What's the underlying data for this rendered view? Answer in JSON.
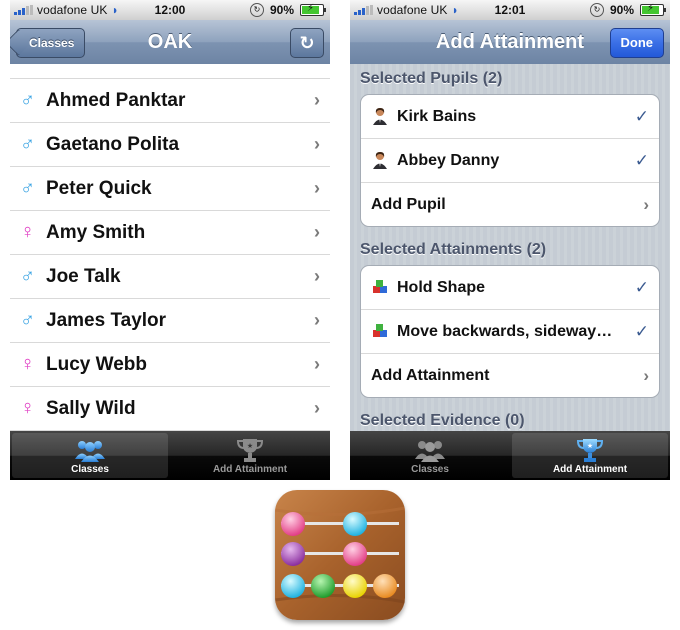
{
  "left": {
    "status": {
      "carrier": "vodafone UK",
      "time": "12:00",
      "battery": "90%"
    },
    "nav": {
      "back": "Classes",
      "title": "OAK",
      "refresh_icon": "refresh-icon"
    },
    "pupils": [
      {
        "name": "Ahmed Panktar",
        "gender": "male"
      },
      {
        "name": "Gaetano Polita",
        "gender": "male"
      },
      {
        "name": "Peter Quick",
        "gender": "male"
      },
      {
        "name": "Amy Smith",
        "gender": "female"
      },
      {
        "name": "Joe Talk",
        "gender": "male"
      },
      {
        "name": "James Taylor",
        "gender": "male"
      },
      {
        "name": "Lucy Webb",
        "gender": "female"
      },
      {
        "name": "Sally Wild",
        "gender": "female"
      }
    ],
    "tabs": [
      {
        "label": "Classes",
        "active": true
      },
      {
        "label": "Add Attainment",
        "active": false
      }
    ]
  },
  "right": {
    "status": {
      "carrier": "vodafone UK",
      "time": "12:01",
      "battery": "90%"
    },
    "nav": {
      "title": "Add Attainment",
      "done": "Done"
    },
    "sections": {
      "pupils_header": "Selected Pupils (2)",
      "pupils": [
        {
          "label": "Kirk Bains"
        },
        {
          "label": "Abbey Danny"
        }
      ],
      "add_pupil": "Add Pupil",
      "attainments_header": "Selected Attainments (2)",
      "attainments": [
        {
          "label": "Hold Shape"
        },
        {
          "label": "Move backwards, sideway…"
        }
      ],
      "add_attainment": "Add Attainment",
      "evidence_header": "Selected Evidence (0)"
    },
    "tabs": [
      {
        "label": "Classes",
        "active": false
      },
      {
        "label": "Add Attainment",
        "active": true
      }
    ]
  },
  "colors": {
    "male": "#39a3e3",
    "female": "#e03fc4",
    "nav": "#6d84a4",
    "done": "#2359d8"
  },
  "app_icon": "abacus-icon"
}
